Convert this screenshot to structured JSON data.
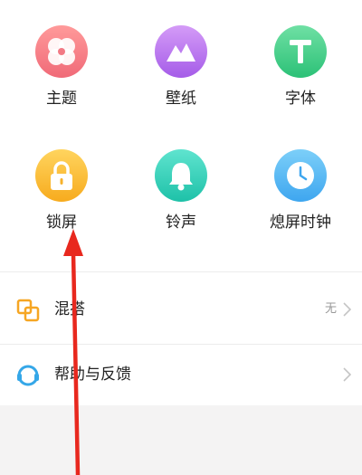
{
  "grid": {
    "items": [
      {
        "label": "主题",
        "icon": "theme-icon",
        "color_top": "#ff9a9a",
        "color_bottom": "#f06a78"
      },
      {
        "label": "壁纸",
        "icon": "wallpaper-icon",
        "color_top": "#d49bf7",
        "color_bottom": "#a55ce8"
      },
      {
        "label": "字体",
        "icon": "font-icon",
        "color_top": "#6fe0a4",
        "color_bottom": "#2cc177"
      },
      {
        "label": "锁屏",
        "icon": "lock-icon",
        "color_top": "#ffd45e",
        "color_bottom": "#f7ab1e"
      },
      {
        "label": "铃声",
        "icon": "bell-icon",
        "color_top": "#5fe4cf",
        "color_bottom": "#1ec1a8"
      },
      {
        "label": "熄屏时钟",
        "icon": "clock-icon",
        "color_top": "#7ccff9",
        "color_bottom": "#3ea6ef"
      }
    ]
  },
  "list": {
    "items": [
      {
        "label": "混搭",
        "value": "无",
        "icon": "mix-match-icon"
      },
      {
        "label": "帮助与反馈",
        "value": "",
        "icon": "help-feedback-icon"
      }
    ]
  },
  "annotation": {
    "arrow_color": "#e8281e"
  }
}
